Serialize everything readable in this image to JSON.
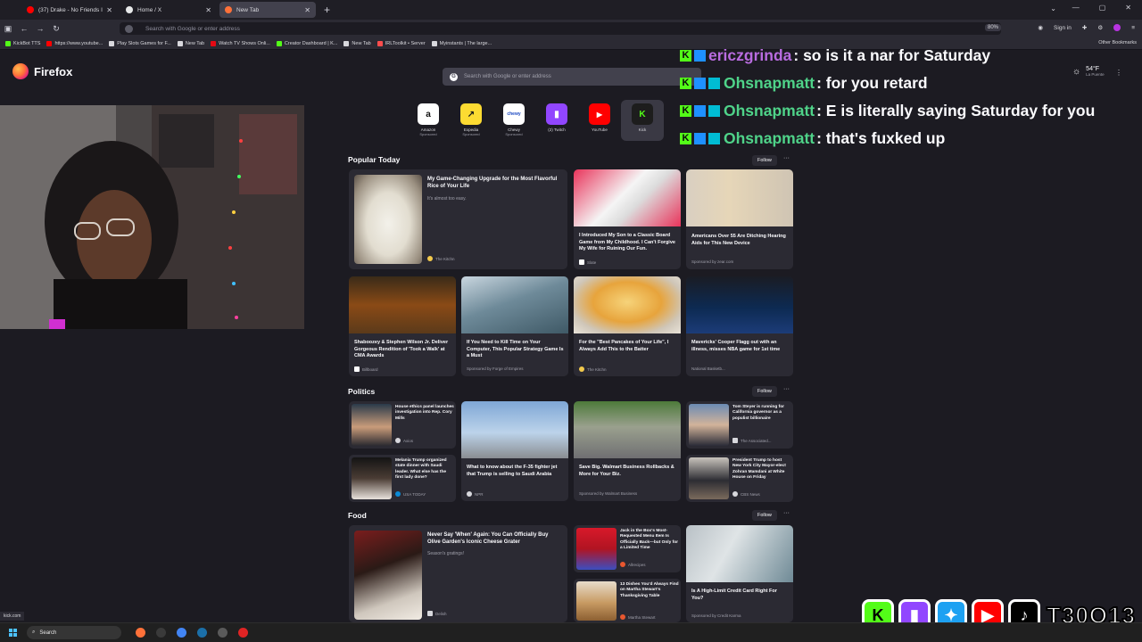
{
  "tabs": [
    {
      "title": "(37) Drake - No Friends In The ",
      "color": "#ff0000",
      "active": false
    },
    {
      "title": "Home / X",
      "color": "#e7e9ea",
      "active": false
    },
    {
      "title": "New Tab",
      "color": "#ff7139",
      "active": true
    }
  ],
  "urlbar": {
    "placeholder": "Search with Google or enter address",
    "zoom": "80%"
  },
  "nav_right": {
    "signin": "Sign in"
  },
  "bookmarks": [
    {
      "label": "KickBot TTS",
      "color": "#53fc18"
    },
    {
      "label": "https://www.youtube...",
      "color": "#ff0000"
    },
    {
      "label": "Play Slots Games for F...",
      "color": "#d8d8dd"
    },
    {
      "label": "New Tab",
      "color": "#d8d8dd"
    },
    {
      "label": "Watch TV Shows Onli...",
      "color": "#e50914"
    },
    {
      "label": "Creator Dashboard | K...",
      "color": "#53fc18"
    },
    {
      "label": "New Tab",
      "color": "#d8d8dd"
    },
    {
      "label": "IRLToolkit • Server",
      "color": "#ff4d4d"
    },
    {
      "label": "Myinstants | The large...",
      "color": "#d8d8dd"
    }
  ],
  "other_bookmarks": "Other Bookmarks",
  "brand": "Firefox",
  "search": {
    "placeholder": "Search with Google or enter address"
  },
  "weather": {
    "temp": "54°F",
    "location": "La Puente"
  },
  "shortcuts": [
    {
      "label": "Amazon",
      "sponsored": "Sponsored",
      "glyph": "a",
      "bg": "#ffffff",
      "fg": "#111111"
    },
    {
      "label": "Expedia",
      "sponsored": "Sponsored",
      "glyph": "↗",
      "bg": "#fddb32",
      "fg": "#1a1a1a"
    },
    {
      "label": "Chewy",
      "sponsored": "Sponsored",
      "glyph": "chewy",
      "bg": "#ffffff",
      "fg": "#1c49c2"
    },
    {
      "label": "(2) Twitch",
      "sponsored": "",
      "glyph": "▮",
      "bg": "#9146ff",
      "fg": "#ffffff"
    },
    {
      "label": "YouTube",
      "sponsored": "",
      "glyph": "▶",
      "bg": "#ff0000",
      "fg": "#ffffff"
    },
    {
      "label": "Kick",
      "sponsored": "",
      "glyph": "K",
      "bg": "#1d1d1d",
      "fg": "#53fc18"
    }
  ],
  "sections": {
    "popular": {
      "title": "Popular Today",
      "follow": "Follow"
    },
    "politics": {
      "title": "Politics",
      "follow": "Follow"
    },
    "food": {
      "title": "Food",
      "follow": "Follow"
    }
  },
  "popular_cards": [
    {
      "title": "My Game-Changing Upgrade for the Most Flavorful Rice of Your Life",
      "sub": "It's almost too easy.",
      "source": "The Kitchn"
    },
    {
      "title": "I Introduced My Son to a Classic Board Game from My Childhood. I Can't Forgive My Wife for Ruining Our Fun.",
      "sub": "",
      "source": "Slate"
    },
    {
      "title": "Americans Over 55 Are Ditching Hearing Aids for This New Device",
      "sub": "",
      "source": "Sponsored by zear.com"
    },
    {
      "title": "Shaboozey & Stephen Wilson Jr. Deliver Gorgeous Rendition of 'Took a Walk' at CMA Awards",
      "sub": "",
      "source": "Billboard"
    },
    {
      "title": "If You Need to Kill Time on Your Computer, This Popular Strategy Game Is a Must",
      "sub": "",
      "source": "Sponsored by Forge of Empires"
    },
    {
      "title": "For the \"Best Pancakes of Your Life\", I Always Add This to the Batter",
      "sub": "",
      "source": "The Kitchn"
    },
    {
      "title": "Mavericks' Cooper Flagg out with an illness, misses NBA game for 1st time",
      "sub": "",
      "source": "National Basketb..."
    }
  ],
  "politics_cards": [
    {
      "title": "House ethics panel launches investigation into Rep. Cory Mills",
      "source": "Axios"
    },
    {
      "title": "What to know about the F-35 fighter jet that Trump is selling to Saudi Arabia",
      "source": "NPR"
    },
    {
      "title": "Save Big. Walmart Business Rollbacks & More for Your Biz.",
      "source": "Sponsored by Walmart Business"
    },
    {
      "title": "Tom Steyer is running for California governor as a populist billionaire",
      "source": "The Associated..."
    },
    {
      "title": "Melania Trump organized state dinner with Saudi leader. What else has the first lady done?",
      "source": "USA TODAY"
    },
    {
      "title": "President Trump to host New York City Mayor-elect Zohran Mamdani at White House on Friday",
      "source": "CBS News"
    }
  ],
  "food_cards": [
    {
      "title": "Never Say 'When' Again: You Can Officially Buy Olive Garden's Iconic Cheese Grater",
      "sub": "Season's gratings!",
      "source": "Delish"
    },
    {
      "title": "Jack in the Box's Most-Requested Menu Item Is Officially Back—but Only for a Limited Time",
      "source": "Allrecipes"
    },
    {
      "title": "13 Dishes You'd Always Find on Martha Stewart's Thanksgiving Table",
      "source": "Martha Stewart"
    },
    {
      "title": "Is A High-Limit Credit Card Right For You?",
      "source": "Sponsored by Credit Karma"
    }
  ],
  "chat": [
    {
      "user": "ericzgrinda",
      "color": "#b96ce0",
      "message": ": so is it a nar for Saturday"
    },
    {
      "user": "Ohsnapmatt",
      "color": "#4fd389",
      "message": ": for you retard"
    },
    {
      "user": "Ohsnapmatt",
      "color": "#4fd389",
      "message": ": E is literally saying Saturday for you"
    },
    {
      "user": "Ohsnapmatt",
      "color": "#4fd389",
      "message": ": that's fuxked up"
    }
  ],
  "social_handle": "T30Q13",
  "status_url": "kick.com",
  "taskbar": {
    "search": "Search"
  }
}
